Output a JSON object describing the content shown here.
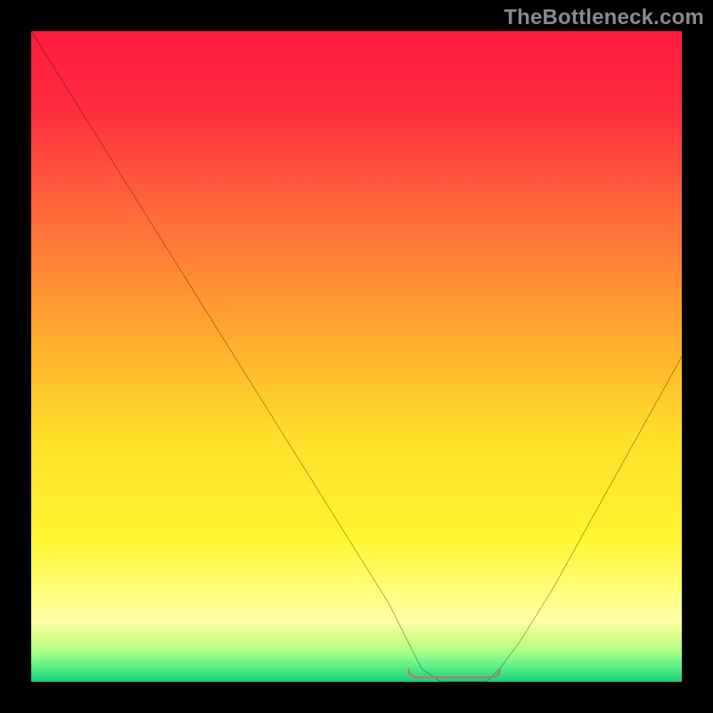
{
  "watermark": "TheBottleneck.com",
  "colors": {
    "frame": "#000000",
    "curve": "#000000",
    "optimal_marker": "#cf6a5f",
    "gradient_stops": [
      {
        "offset": 0.0,
        "color": "#ff1a3e"
      },
      {
        "offset": 0.12,
        "color": "#ff2d3e"
      },
      {
        "offset": 0.28,
        "color": "#ff6a3a"
      },
      {
        "offset": 0.45,
        "color": "#ffa32e"
      },
      {
        "offset": 0.62,
        "color": "#ffde2a"
      },
      {
        "offset": 0.78,
        "color": "#fff531"
      },
      {
        "offset": 0.86,
        "color": "#ffff7a"
      },
      {
        "offset": 0.905,
        "color": "#ffffa8"
      },
      {
        "offset": 0.93,
        "color": "#d9ff8a"
      },
      {
        "offset": 0.955,
        "color": "#a8ff82"
      },
      {
        "offset": 0.975,
        "color": "#62f08a"
      },
      {
        "offset": 1.0,
        "color": "#17d276"
      }
    ]
  },
  "chart_data": {
    "type": "line",
    "title": "",
    "xlabel": "",
    "ylabel": "",
    "xlim": [
      0,
      100
    ],
    "ylim": [
      0,
      100
    ],
    "grid": false,
    "legend": false,
    "series": [
      {
        "name": "bottleneck-curve",
        "x": [
          0,
          5,
          10,
          15,
          20,
          25,
          30,
          35,
          40,
          45,
          50,
          55,
          58,
          60,
          63,
          66,
          70,
          72,
          75,
          80,
          85,
          90,
          95,
          100
        ],
        "values": [
          100,
          92,
          84,
          76,
          68,
          60,
          52,
          44,
          36,
          28,
          20,
          12,
          6,
          2,
          0,
          0,
          0,
          2,
          6,
          14,
          23,
          32,
          41,
          50
        ]
      }
    ],
    "annotations": [
      {
        "name": "optimal-range",
        "x_start": 58,
        "x_end": 72,
        "y": 0
      }
    ]
  }
}
